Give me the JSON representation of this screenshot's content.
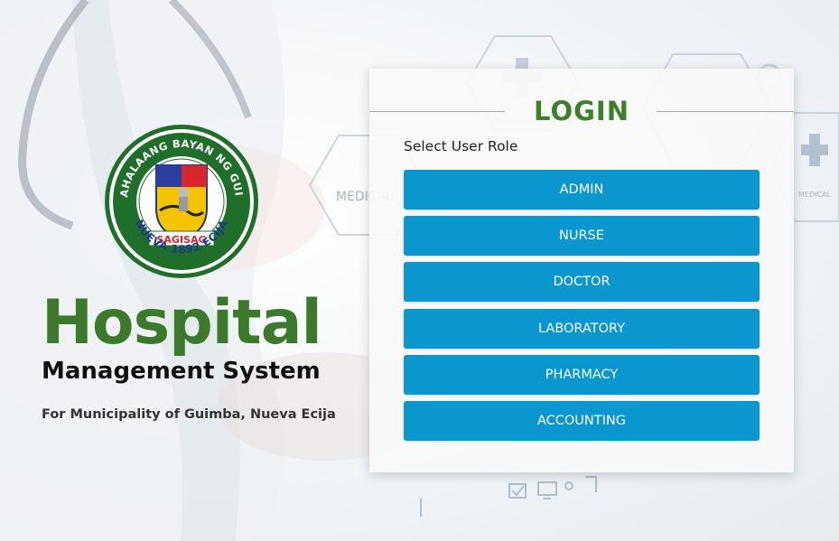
{
  "branding": {
    "seal_text_top": "PAMAHALAANG BAYAN NG GUIMBA",
    "seal_text_mid": "SAGISAG",
    "seal_text_bottom": "NUEVA 1892 ECIJA",
    "title": "Hospital",
    "subtitle": "Management System",
    "tagline": "For Municipality of Guimba, Nueva Ecija"
  },
  "background": {
    "hex_label_1": "MEDICAL",
    "hex_label_2": "MEDICAL"
  },
  "login": {
    "title": "LOGIN",
    "role_label": "Select User Role",
    "roles": [
      "ADMIN",
      "NURSE",
      "DOCTOR",
      "LABORATORY",
      "PHARMACY",
      "ACCOUNTING"
    ]
  },
  "colors": {
    "brand_green": "#3f7f2a",
    "button_blue": "#0a97cf"
  }
}
